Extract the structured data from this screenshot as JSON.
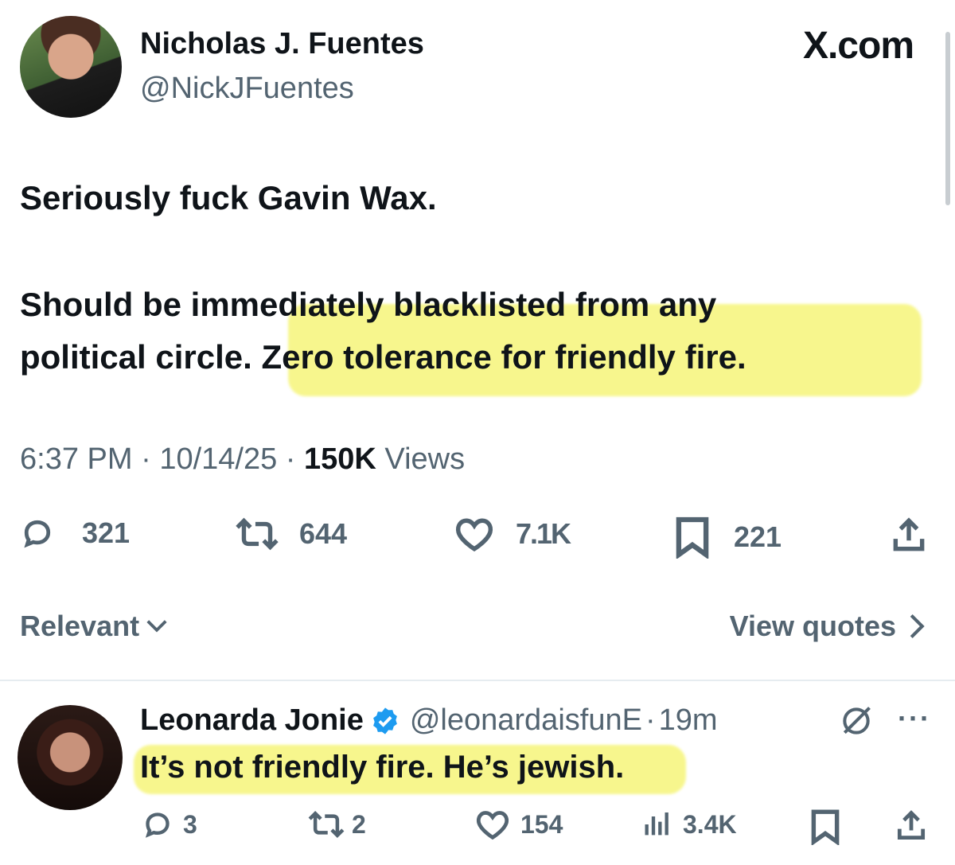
{
  "tweet": {
    "author_name": "Nicholas J. Fuentes",
    "author_handle": "@NickJFuentes",
    "site_label": "X.com",
    "line1": "Seriously fuck Gavin Wax.",
    "line2": "Should be immediately blacklisted from any",
    "line3a": "political circle.",
    "line3b": " Zero tolerance for friendly fire.",
    "time": "6:37 PM",
    "date": "10/14/25",
    "views_count": "150K",
    "views_label": "Views",
    "separator": "·",
    "replies": "321",
    "reposts": "644",
    "likes": "7.1K",
    "bookmarks": "221"
  },
  "controls": {
    "sort_label": "Relevant",
    "view_quotes_label": "View quotes"
  },
  "reply": {
    "author_name": "Leonarda Jonie",
    "author_handle": "@leonardaisfunE",
    "separator": "·",
    "time_ago": "19m",
    "text": "It’s not friendly fire. He’s jewish.",
    "replies": "3",
    "reposts": "2",
    "likes": "154",
    "views": "3.4K"
  },
  "colors": {
    "highlight": "#f6f57a",
    "verified": "#1d9bf0",
    "secondary_text": "#536471"
  }
}
